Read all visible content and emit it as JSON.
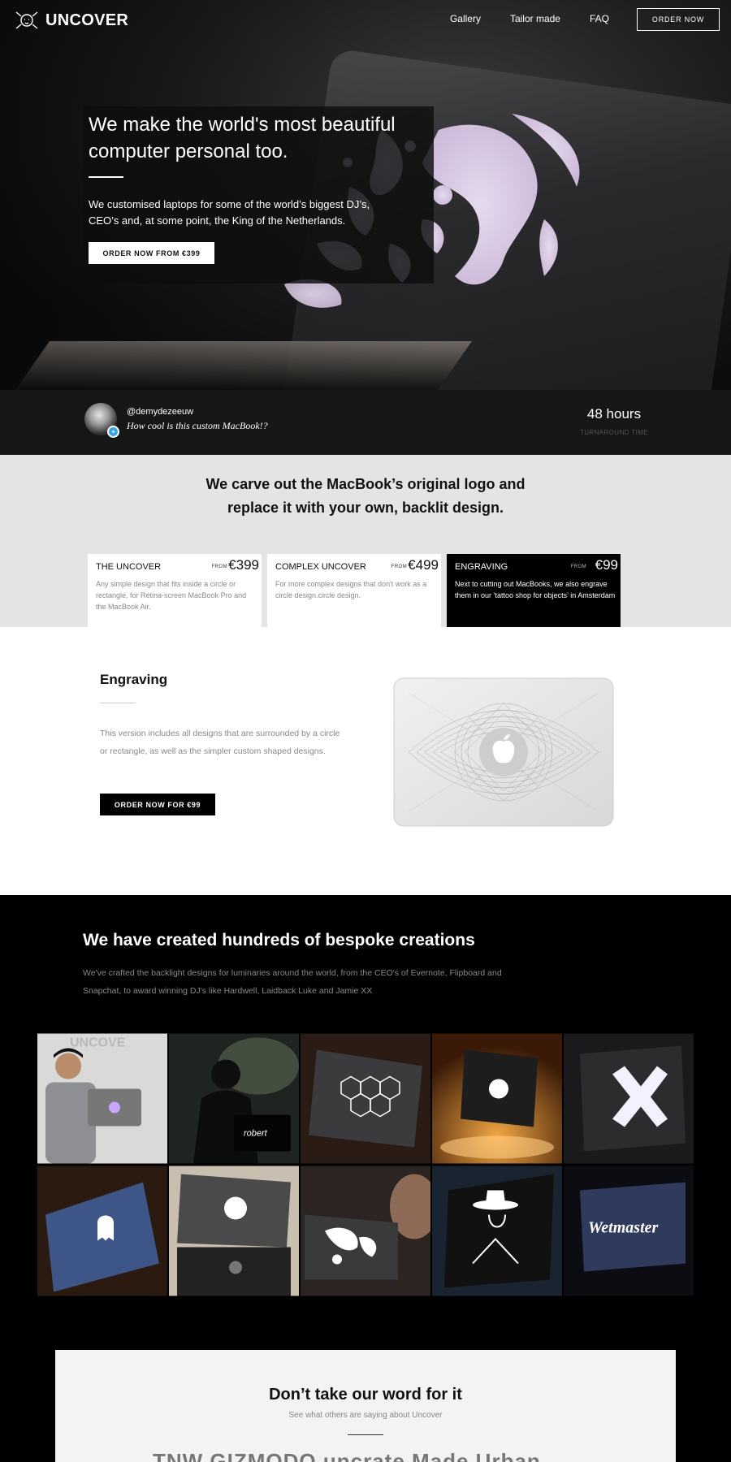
{
  "brand": {
    "name": "UNCOVER"
  },
  "nav": {
    "links": [
      "Gallery",
      "Tailor made",
      "FAQ"
    ],
    "order_label": "ORDER NOW"
  },
  "hero": {
    "title": "We make the world's most beautiful computer personal too.",
    "subtitle": "We customised laptops for some of the world’s biggest DJ’s, CEO’s and, at some point, the King of the Netherlands.",
    "cta": "ORDER NOW FROM €399"
  },
  "testimonial": {
    "handle": "@demydezeeuw",
    "quote": "How cool is this custom MacBook!?",
    "stat_value": "48 hours",
    "stat_label": "TURNAROUND TIME"
  },
  "pricing": {
    "heading": "We carve out the MacBook’s original logo and replace it with your own, backlit design.",
    "cards": [
      {
        "title": "THE UNCOVER",
        "from": "FROM",
        "price": "€399",
        "desc": "Any simple design that fits inside a circle or rectangle, for Retina-screen MacBook Pro and the MacBook Air."
      },
      {
        "title": "COMPLEX UNCOVER",
        "from": "FROM",
        "price": "€499",
        "desc": "For more complex designs that don't work as a circle design.circle design."
      },
      {
        "title": "ENGRAVING",
        "from": "FROM",
        "price": "€99",
        "desc": "Next to cutting out MacBooks, we also engrave them in our ‘tattoo shop for objects’ in Amsterdam"
      }
    ]
  },
  "engraving": {
    "title": "Engraving",
    "desc": "This version includes all designs that are surrounded by a circle or rectangle, as well as the simpler custom shaped designs.",
    "cta": "ORDER NOW FOR €99"
  },
  "gallery": {
    "title": "We have created hundreds of bespoke creations",
    "desc": "We've crafted the backlight designs for luminaries around the world, from the CEO's of Evernote, Flipboard and Snapchat, to award winning DJ's like Hardwell, Laidback Luke and Jamie XX",
    "tiles": [
      "person-with-laptop",
      "dj-booth",
      "hexagon-laptop",
      "glowing-leaf-laptop",
      "cross-laptop",
      "ghost-laptop",
      "evernote-laptop",
      "woman-illustration-laptop",
      "hat-man-laptop",
      "graffiti-laptop"
    ]
  },
  "reviews": {
    "title": "Don’t take our word for it",
    "subtitle": "See what others are saying about Uncover",
    "logos": "TNW  GIZMODO  uncrate  Made Urban"
  },
  "colors": {
    "dark": "#161616",
    "light_gray": "#e4e4e4",
    "black": "#000000",
    "accent_twitter": "#3aa5e8"
  }
}
